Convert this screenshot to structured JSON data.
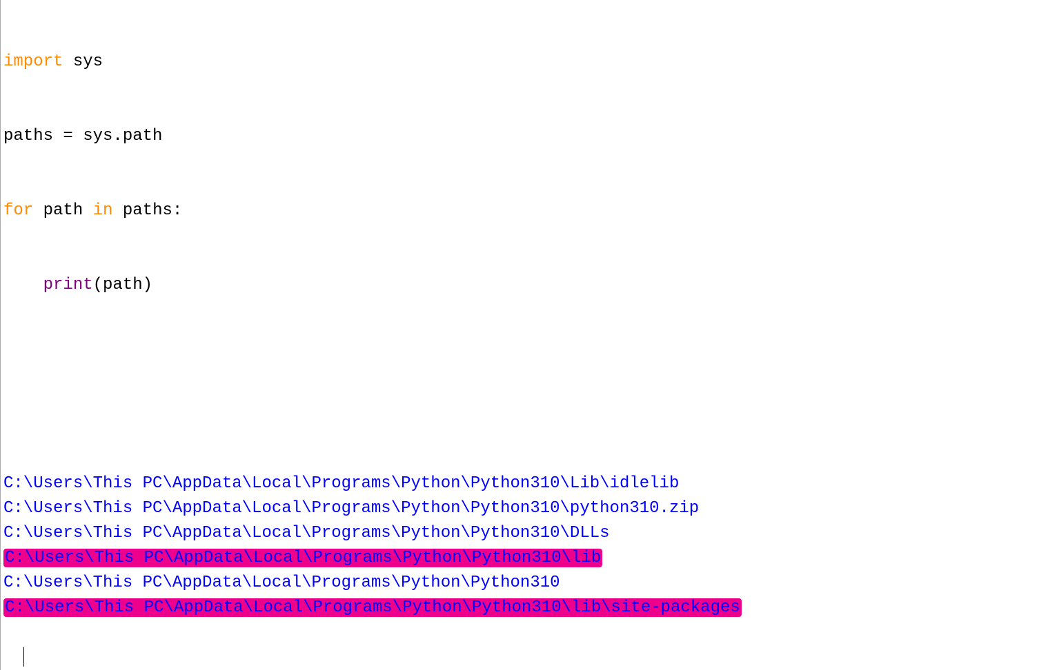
{
  "code": {
    "line1": {
      "import": "import",
      "sys": " sys"
    },
    "line2": "paths = sys.path",
    "line3": {
      "for": "for",
      "path": " path ",
      "in": "in",
      "paths": " paths:"
    },
    "line4": {
      "indent": "    ",
      "print": "print",
      "args": "(path)"
    }
  },
  "output": {
    "lines": [
      "C:\\Users\\This PC\\AppData\\Local\\Programs\\Python\\Python310\\Lib\\idlelib",
      "C:\\Users\\This PC\\AppData\\Local\\Programs\\Python\\Python310\\python310.zip",
      "C:\\Users\\This PC\\AppData\\Local\\Programs\\Python\\Python310\\DLLs",
      "C:\\Users\\This PC\\AppData\\Local\\Programs\\Python\\Python310\\lib",
      "C:\\Users\\This PC\\AppData\\Local\\Programs\\Python\\Python310",
      "C:\\Users\\This PC\\AppData\\Local\\Programs\\Python\\Python310\\lib\\site-packages"
    ],
    "highlighted_indices": [
      3,
      5
    ]
  }
}
